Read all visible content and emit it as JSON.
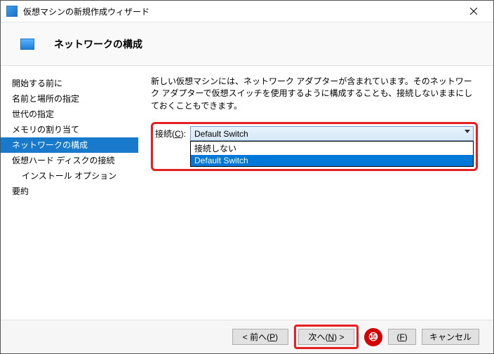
{
  "window": {
    "title": "仮想マシンの新規作成ウィザード"
  },
  "header": {
    "title": "ネットワークの構成"
  },
  "sidebar": {
    "items": [
      {
        "label": "開始する前に"
      },
      {
        "label": "名前と場所の指定"
      },
      {
        "label": "世代の指定"
      },
      {
        "label": "メモリの割り当て"
      },
      {
        "label": "ネットワークの構成"
      },
      {
        "label": "仮想ハード ディスクの接続"
      },
      {
        "label": "インストール オプション"
      },
      {
        "label": "要約"
      }
    ]
  },
  "main": {
    "description": "新しい仮想マシンには、ネットワーク アダプターが含まれています。そのネットワーク アダプターで仮想スイッチを使用するように構成することも、接続しないままにしておくこともできます。",
    "combo_label_prefix": "接続(",
    "combo_label_letter": "C",
    "combo_label_suffix": "):",
    "combo_selected": "Default Switch",
    "options": [
      {
        "label": "接続しない"
      },
      {
        "label": "Default Switch"
      }
    ]
  },
  "footer": {
    "prev_prefix": "< 前へ(",
    "prev_letter": "P",
    "prev_suffix": ")",
    "next_prefix": "次へ(",
    "next_letter": "N",
    "next_suffix": ") >",
    "finish_prefix": "(",
    "finish_letter": "F",
    "finish_suffix": ")",
    "cancel": "キャンセル",
    "annotation_number": "⑩"
  }
}
